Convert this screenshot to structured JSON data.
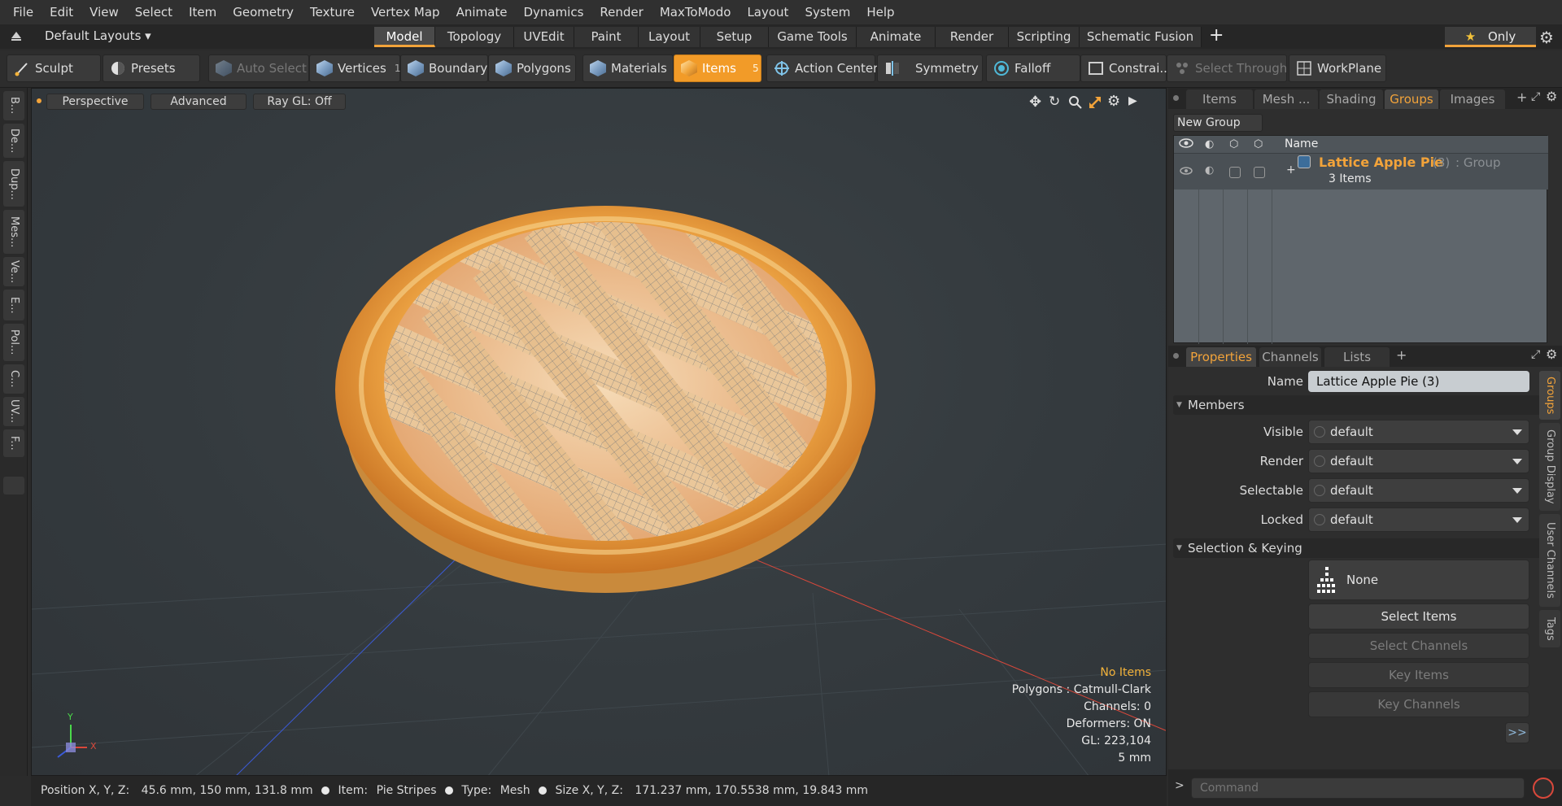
{
  "menu": [
    "File",
    "Edit",
    "View",
    "Select",
    "Item",
    "Geometry",
    "Texture",
    "Vertex Map",
    "Animate",
    "Dynamics",
    "Render",
    "MaxToModo",
    "Layout",
    "System",
    "Help"
  ],
  "layout_bar": {
    "preset": "Default Layouts ▾",
    "tabs": [
      "Model",
      "Topology",
      "UVEdit",
      "Paint",
      "Layout",
      "Setup",
      "Game Tools",
      "Animate",
      "Render",
      "Scripting",
      "Schematic Fusion"
    ],
    "active_tab": "Model",
    "add": "+",
    "only": "Only"
  },
  "toolbar": {
    "sculpt": "Sculpt",
    "presets": "Presets",
    "auto_select": "Auto Select",
    "vertices": "Vertices",
    "vertices_count": "1",
    "boundary": "Boundary",
    "polygons": "Polygons",
    "materials": "Materials",
    "items": "Items",
    "items_count": "5",
    "action_center": "Action Center",
    "symmetry": "Symmetry",
    "falloff": "Falloff",
    "constraints": "Constrai...",
    "select_through": "Select Through",
    "workplane": "WorkPlane"
  },
  "left_tabs": [
    "B...",
    "De...",
    "Dup...",
    "Mes...",
    "Ve...",
    "E...",
    "Pol...",
    "C...",
    "UV...",
    "F..."
  ],
  "viewport": {
    "view_mode": "Perspective",
    "shading": "Advanced",
    "raygl": "Ray GL: Off",
    "info": {
      "no_items": "No Items",
      "polygons": "Polygons : Catmull-Clark",
      "channels": "Channels: 0",
      "deformers": "Deformers: ON",
      "gl": "GL: 223,104",
      "grid": "5 mm"
    },
    "axis_x": "X",
    "axis_y": "Y",
    "accent_x": "#d9483b",
    "accent_z": "#3b5bd9"
  },
  "status": {
    "position_label": "Position X, Y, Z:",
    "position_value": "45.6 mm, 150 mm, 131.8 mm",
    "item_label": "Item:",
    "item_value": "Pie Stripes",
    "type_label": "Type:",
    "type_value": "Mesh",
    "size_label": "Size X, Y, Z:",
    "size_value": "171.237 mm, 170.5538 mm, 19.843 mm"
  },
  "groups_panel": {
    "tabs": [
      "Items",
      "Mesh ...",
      "Shading",
      "Groups",
      "Images"
    ],
    "active_tab": "Groups",
    "new_group": "New Group",
    "col_name": "Name",
    "group": {
      "name": "Lattice Apple Pie",
      "count": "(3)",
      "type": ": Group",
      "items": "3 Items",
      "expand": "+"
    }
  },
  "properties_panel": {
    "tabs": [
      "Properties",
      "Channels",
      "Lists"
    ],
    "active_tab": "Properties",
    "name_label": "Name",
    "name_value": "Lattice Apple Pie (3)",
    "members_header": "Members",
    "rows": [
      {
        "label": "Visible",
        "value": "default"
      },
      {
        "label": "Render",
        "value": "default"
      },
      {
        "label": "Selectable",
        "value": "default"
      },
      {
        "label": "Locked",
        "value": "default"
      }
    ],
    "selection_header": "Selection & Keying",
    "none_btn": "None",
    "select_items": "Select Items",
    "select_channels": "Select Channels",
    "key_items": "Key Items",
    "key_channels": "Key Channels",
    "more": ">>",
    "side_tabs": [
      "Groups",
      "Group Display",
      "User Channels",
      "Tags"
    ],
    "active_side_tab": "Groups"
  },
  "command": {
    "prompt": ">",
    "placeholder": "Command"
  }
}
